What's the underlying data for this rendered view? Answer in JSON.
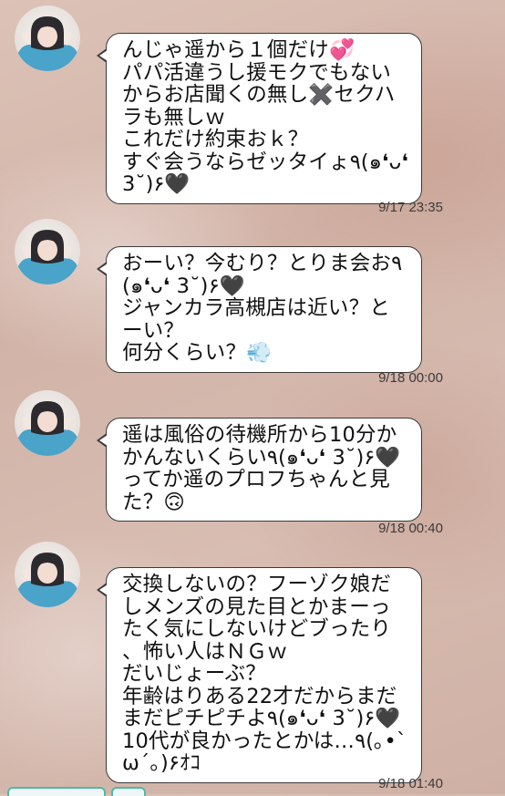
{
  "messages": [
    {
      "lines": [
        "んじゃ遥から１個だけ💞",
        "パパ活違うし援モクでもない",
        "からお店聞くの無し✖️セクハ",
        "ラも無しｗ",
        "これだけ約束おｋ？",
        "すぐ会うならゼッタイょ٩(๑❛ᴗ❛",
        "3˘)۶🖤"
      ],
      "time": "9/17 23:35"
    },
    {
      "lines": [
        "おーい？今むり？とりま会お٩",
        "(๑❛ᴗ❛ 3˘)۶🖤",
        "ジャンカラ高槻店は近い？と",
        "ーい？",
        "何分くらい？💨"
      ],
      "time": "9/18 00:00"
    },
    {
      "lines": [
        "遥は風俗の待機所から10分か",
        "かんないくらい٩(๑❛ᴗ❛ 3˘)۶🖤",
        "ってか遥のプロフちゃんと見",
        "た？🙃"
      ],
      "time": "9/18 00:40"
    },
    {
      "lines": [
        "交換しないの？フーゾク娘だ",
        "しメンズの見た目とかまーっ",
        "たく気にしないけどブったり",
        "、怖い人はＮＧｗ",
        "だいじょーぶ？",
        "年齢はりある22才だからまだ",
        "まだピチピチよ٩(๑❛ᴗ❛ 3˘)۶🖤",
        "10代が良かったとかは…٩(｡•`",
        "ω´｡)۶ｵｺ"
      ],
      "time": "9/18 01:40"
    }
  ]
}
